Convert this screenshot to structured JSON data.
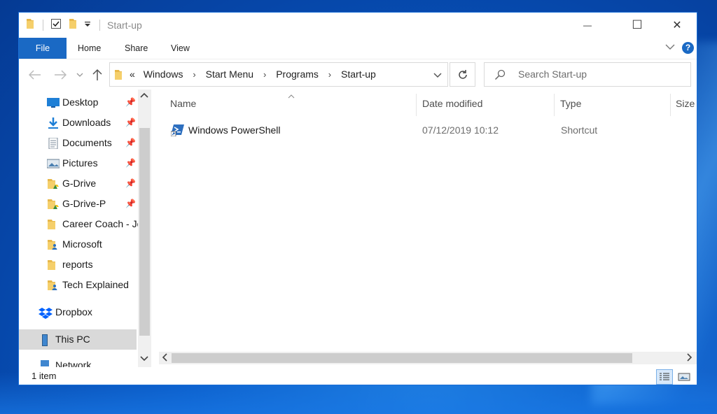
{
  "window": {
    "title": "Start-up",
    "min_glyph": "—",
    "max_glyph": "☐",
    "close_glyph": "✕"
  },
  "ribbon": {
    "tabs": [
      "File",
      "Home",
      "Share",
      "View"
    ]
  },
  "address": {
    "overflow": "«",
    "crumbs": [
      "Windows",
      "Start Menu",
      "Programs",
      "Start-up"
    ],
    "separator": "›"
  },
  "search": {
    "placeholder": "Search Start-up"
  },
  "sidebar": {
    "quick_access": [
      {
        "label": "Desktop",
        "icon": "desktop-icon",
        "pinned": true
      },
      {
        "label": "Downloads",
        "icon": "downloads-icon",
        "pinned": true
      },
      {
        "label": "Documents",
        "icon": "documents-icon",
        "pinned": true
      },
      {
        "label": "Pictures",
        "icon": "pictures-icon",
        "pinned": true
      },
      {
        "label": "G-Drive",
        "icon": "gdrive-folder-icon",
        "pinned": true
      },
      {
        "label": "G-Drive-P",
        "icon": "gdrive-folder-icon",
        "pinned": true
      },
      {
        "label": "Career Coach - Jo",
        "icon": "folder-icon",
        "pinned": false
      },
      {
        "label": "Microsoft",
        "icon": "shared-folder-icon",
        "pinned": false
      },
      {
        "label": "reports",
        "icon": "folder-icon",
        "pinned": false
      },
      {
        "label": "Tech Explained",
        "icon": "shared-folder-icon",
        "pinned": false
      }
    ],
    "dropbox": "Dropbox",
    "this_pc": "This PC",
    "network": "Network"
  },
  "columns": [
    "Name",
    "Date modified",
    "Type",
    "Size"
  ],
  "files": [
    {
      "name": "Windows PowerShell",
      "date": "07/12/2019 10:12",
      "type": "Shortcut"
    }
  ],
  "status": {
    "count": "1 item"
  },
  "colors": {
    "accent": "#1a69c4",
    "selected": "#d9d9d9"
  }
}
